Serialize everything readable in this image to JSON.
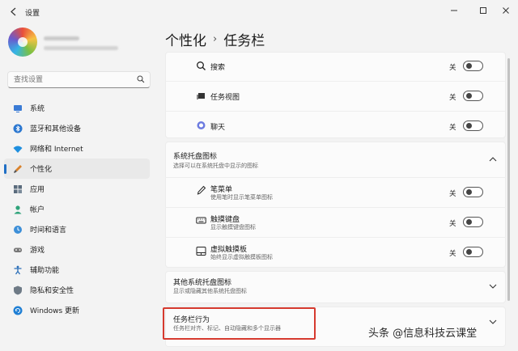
{
  "window": {
    "title": "设置"
  },
  "sidebar": {
    "search_placeholder": "查找设置",
    "items": [
      {
        "label": "系统",
        "icon": "monitor-icon"
      },
      {
        "label": "蓝牙和其他设备",
        "icon": "bluetooth-icon"
      },
      {
        "label": "网络和 Internet",
        "icon": "wifi-icon"
      },
      {
        "label": "个性化",
        "icon": "brush-icon"
      },
      {
        "label": "应用",
        "icon": "apps-icon"
      },
      {
        "label": "帐户",
        "icon": "person-icon"
      },
      {
        "label": "时间和语言",
        "icon": "globe-clock-icon"
      },
      {
        "label": "游戏",
        "icon": "gamepad-icon"
      },
      {
        "label": "辅助功能",
        "icon": "accessibility-icon"
      },
      {
        "label": "隐私和安全性",
        "icon": "shield-icon"
      },
      {
        "label": "Windows 更新",
        "icon": "update-icon"
      }
    ],
    "active_index": 3
  },
  "breadcrumb": {
    "parent": "个性化",
    "separator": "›",
    "current": "任务栏"
  },
  "taskbar_items": [
    {
      "label": "搜索",
      "state": "关",
      "icon": "search-icon"
    },
    {
      "label": "任务视图",
      "state": "关",
      "icon": "task-view-icon"
    },
    {
      "label": "聊天",
      "state": "关",
      "icon": "chat-icon"
    }
  ],
  "tray_icons": {
    "title": "系统托盘图标",
    "subtitle": "选择可以在系统托盘中显示的图标",
    "items": [
      {
        "label": "笔菜单",
        "sub": "使用笔时显示笔菜单图标",
        "state": "关",
        "icon": "pen-icon"
      },
      {
        "label": "触摸键盘",
        "sub": "显示触摸键盘图标",
        "state": "关",
        "icon": "keyboard-icon"
      },
      {
        "label": "虚拟触摸板",
        "sub": "始终显示虚拟触摸板图标",
        "state": "关",
        "icon": "touchpad-icon"
      }
    ]
  },
  "other_tray": {
    "title": "其他系统托盘图标",
    "subtitle": "显示或隐藏其他系统托盘图标"
  },
  "taskbar_behavior": {
    "title": "任务栏行为",
    "subtitle": "任务栏对齐、标记、自动隐藏和多个显示器"
  },
  "watermark": "头条 @信息科技云课堂",
  "colors": {
    "accent": "#1f6fc5",
    "highlight": "#d63a2f"
  }
}
